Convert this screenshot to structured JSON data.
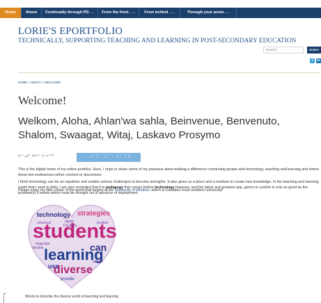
{
  "nav": {
    "items": [
      {
        "label": "Home",
        "active": true
      },
      {
        "label": "About",
        "active": false
      },
      {
        "label": "Continually through PD. . .",
        "active": false
      },
      {
        "label": "From the front . . .",
        "active": false
      },
      {
        "label": "From behind . . .",
        "active": false
      },
      {
        "label": "Through your posts. . .",
        "active": false
      }
    ]
  },
  "header": {
    "title": "LORIE'S EPORTFOLIO",
    "subtitle": "TECHNICALLY, SUPPORTING TEACHING AND LEARNING IN POST-SECONDARY EDUCATION",
    "search_placeholder": "Search",
    "search_button": "SEARCH"
  },
  "social": {
    "items": [
      {
        "icon": "twitter-icon",
        "glyph": "t",
        "color": "#3aa2e3"
      },
      {
        "icon": "linkedin-icon",
        "glyph": "in",
        "color": "#1b78b4"
      }
    ]
  },
  "content": {
    "breadcrumb": "HOME » ABOUT » WELCOME!",
    "page_title": "Welcome!",
    "greeting": "Welkom, Aloha, Ahlan'wa sahla, Beinvenue, Benvenuto, Shalom, Swaagat, Witaj, Laskavo Prosymo",
    "script_text": "ᐅᓪᓗᒥ ᐊᐸᑦ ᓴᓪᓕᑦᑦ",
    "braille_text": "⠠⠺⠑⠇⠉⠕⠍⠑ ⠞⠕ ⠍⠽",
    "para1": "This is the digital home of my online portfolio.  Here, I hope to share some of my passions about making a difference connecting people and technology, teaching and learning and where those two endeavours either connect or disconnect.",
    "para2_a": "I think technology can be an equalizer and enable various challenges to become strengths.  It also gives us a place and a medium to create new knowledge.  In the teaching and learning realm that I work in daily, I am also reminded that it is ",
    "para2_b": "pedagogy",
    "para2_c": " that comes before ",
    "para2_d": "technology",
    "para2_e": " however, and the latest and greatest app, gizmo or system is only as good as the problem(s) it solves which must be thought out in advance of deployment.",
    "para3_a": "Please enjoy my little corner of the world that begins at the ",
    "para3_link": "University of Windsor",
    "para3_b": ", which is Canada's most southern university!",
    "image_words": [
      "technology",
      "strategies",
      "students",
      "can",
      "learning",
      "diverse",
      "provide",
      "English",
      "flexible",
      "use",
      "universal",
      "design",
      "digital",
      "language",
      "Disability"
    ],
    "caption": "Words to describe the diverse world of teaching and learning"
  }
}
